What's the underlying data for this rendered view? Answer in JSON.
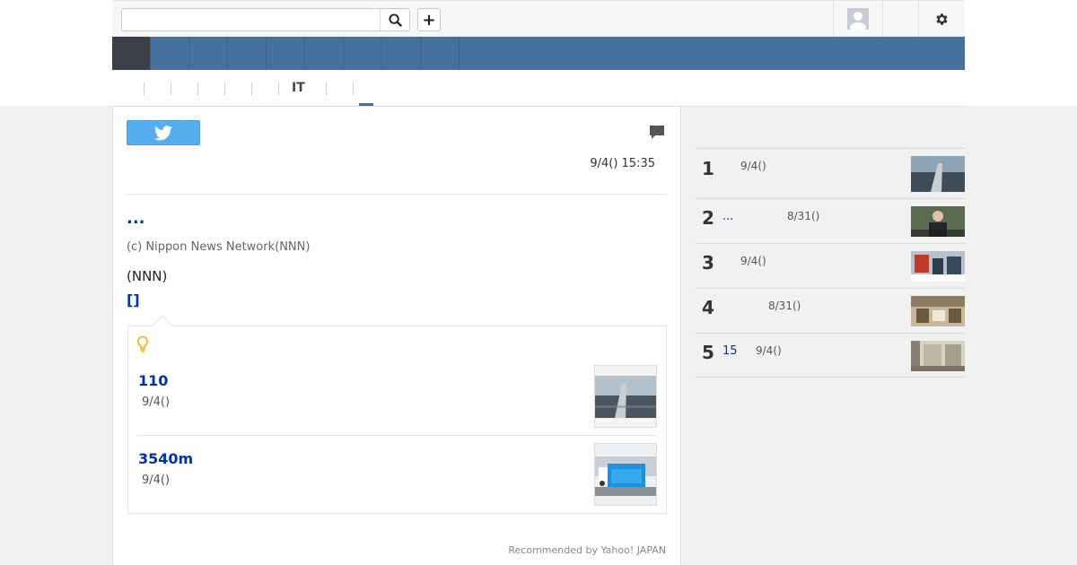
{
  "header": {
    "search": {
      "value": "",
      "placeholder": ""
    }
  },
  "subnav": {
    "active_label": "IT"
  },
  "article": {
    "date": "9/4() 15:35",
    "headline": "...",
    "copyright": "(c) Nippon News Network(NNN)",
    "source": "(NNN)",
    "bracket_link": "[]"
  },
  "related": {
    "items": [
      {
        "title": "110",
        "date": "9/4()"
      },
      {
        "title": "3540m",
        "date": "9/4()"
      }
    ],
    "credit": "Recommended by Yahoo! JAPAN"
  },
  "ranking": [
    {
      "rank": "1",
      "title": "",
      "date": "9/4()"
    },
    {
      "rank": "2",
      "title": "...",
      "date": "8/31()"
    },
    {
      "rank": "3",
      "title": "",
      "date": "9/4()"
    },
    {
      "rank": "4",
      "title": "",
      "date": "8/31()"
    },
    {
      "rank": "5",
      "title": "15",
      "date": "9/4()"
    }
  ],
  "colors": {
    "nav_blue": "#45719c",
    "nav_active": "#3c3f47",
    "link_blue": "#0033aa",
    "twitter_blue": "#55acee",
    "bulb_yellow": "#e8b400"
  },
  "icons": [
    "search-icon",
    "plus-icon",
    "avatar-icon",
    "gear-icon",
    "twitter-icon",
    "comment-icon",
    "lightbulb-icon"
  ]
}
